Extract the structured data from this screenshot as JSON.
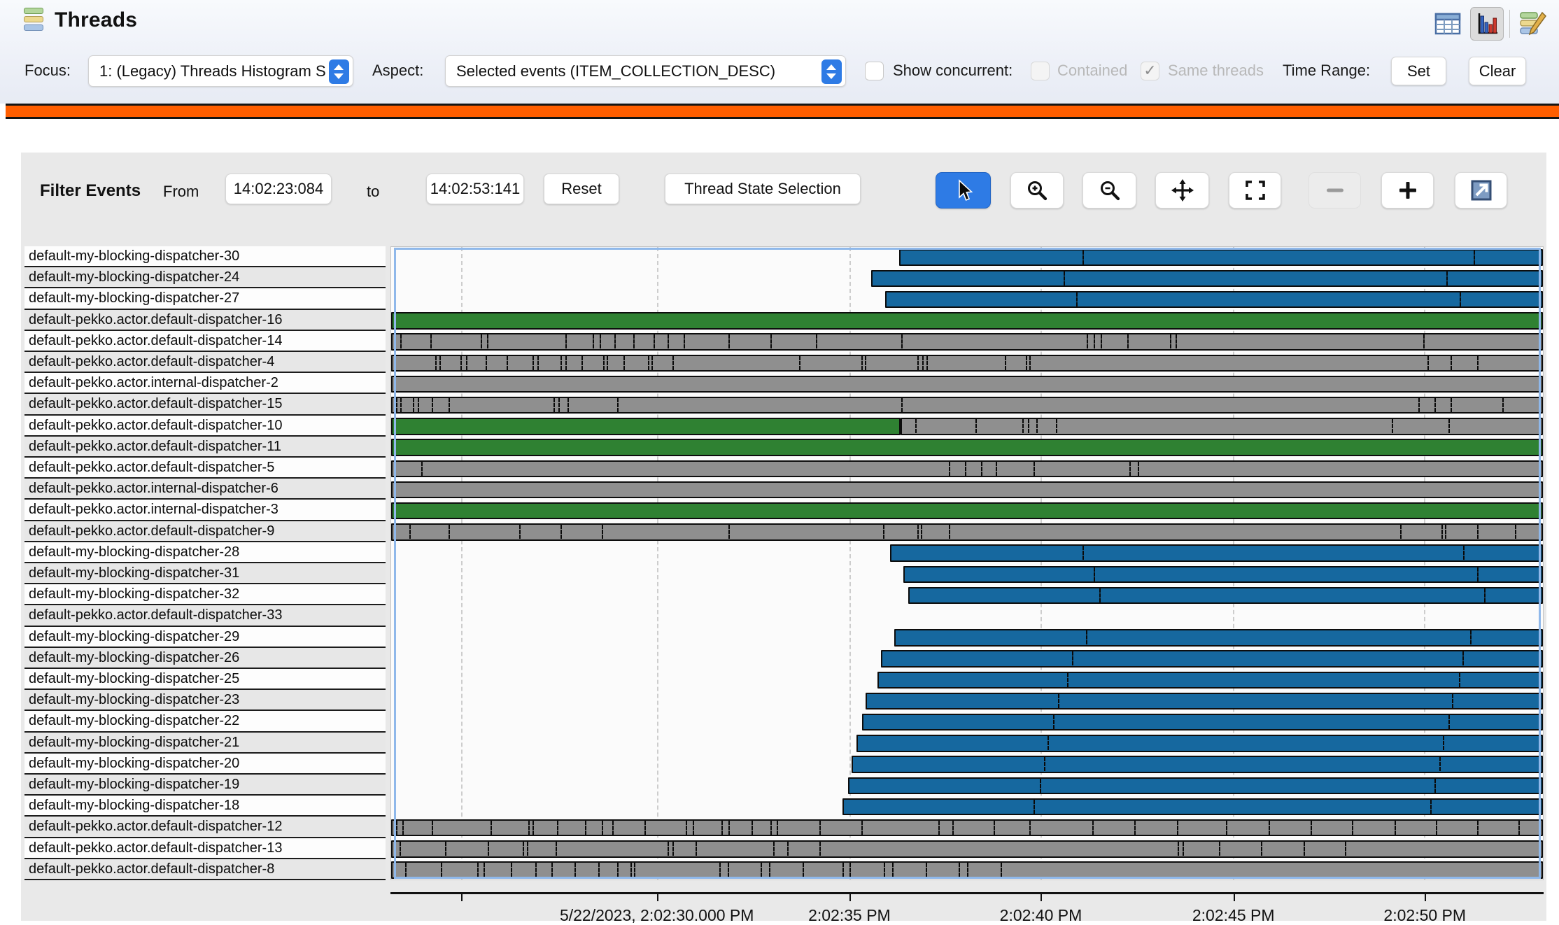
{
  "header": {
    "title": "Threads"
  },
  "controls": {
    "focus_label": "Focus:",
    "focus_value": "1: (Legacy) Threads Histogram S",
    "aspect_label": "Aspect:",
    "aspect_value": "Selected events (ITEM_COLLECTION_DESC)",
    "show_concurrent_label": "Show concurrent:",
    "contained_label": "Contained",
    "same_threads_label": "Same threads",
    "same_threads_check": "✓",
    "time_range_label": "Time Range:",
    "set_label": "Set",
    "clear_label": "Clear"
  },
  "toolbar": {
    "filter_events_label": "Filter Events",
    "from_label": "From",
    "from_value": "14:02:23:084",
    "to_label": "to",
    "to_value": "14:02:53:141",
    "reset_label": "Reset",
    "thread_state_label": "Thread State Selection"
  },
  "colors": {
    "blue": "#16689F",
    "green": "#2F8132",
    "gray": "#8F8F8F",
    "selection": "#8FB8EA",
    "active_tool": "#2E7BE5",
    "orange": "#FF5E00"
  },
  "timeline": {
    "type": "thread-state-timeline",
    "axis": {
      "ticks": [
        {
          "pos": 0.061,
          "label": ""
        },
        {
          "pos": 0.231,
          "label": "5/22/2023, 2:02:30.000 PM"
        },
        {
          "pos": 0.398,
          "label": "2:02:35 PM"
        },
        {
          "pos": 0.564,
          "label": "2:02:40 PM"
        },
        {
          "pos": 0.731,
          "label": "2:02:45 PM"
        },
        {
          "pos": 0.897,
          "label": "2:02:50 PM"
        }
      ]
    },
    "rows": [
      {
        "label": "default-my-blocking-dispatcher-30",
        "segs": [
          [
            "blue",
            0.441,
            1
          ]
        ],
        "ticks": [
          0.6,
          0.94
        ]
      },
      {
        "label": "default-my-blocking-dispatcher-24",
        "segs": [
          [
            "blue",
            0.417,
            1
          ]
        ],
        "ticks": [
          0.584,
          0.916
        ]
      },
      {
        "label": "default-my-blocking-dispatcher-27",
        "segs": [
          [
            "blue",
            0.429,
            1
          ]
        ],
        "ticks": [
          0.595,
          0.928
        ]
      },
      {
        "label": "default-pekko.actor.default-dispatcher-16",
        "segs": [
          [
            "green",
            0,
            1
          ]
        ],
        "ticks": []
      },
      {
        "label": "default-pekko.actor.default-dispatcher-14",
        "segs": [
          [
            "gray",
            0,
            1
          ]
        ],
        "ticks": [
          0.008,
          0.034,
          0.078,
          0.083,
          0.151,
          0.175,
          0.181,
          0.194,
          0.21,
          0.228,
          0.24,
          0.254,
          0.293,
          0.329,
          0.369,
          0.443,
          0.604,
          0.61,
          0.616,
          0.639,
          0.676,
          0.681,
          0.896
        ]
      },
      {
        "label": "default-pekko.actor.default-dispatcher-4",
        "segs": [
          [
            "gray",
            0,
            1
          ]
        ],
        "ticks": [
          0.038,
          0.042,
          0.06,
          0.065,
          0.082,
          0.1,
          0.123,
          0.127,
          0.147,
          0.151,
          0.165,
          0.184,
          0.187,
          0.202,
          0.223,
          0.226,
          0.244,
          0.354,
          0.408,
          0.411,
          0.457,
          0.461,
          0.465,
          0.533,
          0.551,
          0.554,
          0.9,
          0.92,
          0.943
        ]
      },
      {
        "label": "default-pekko.actor.internal-dispatcher-2",
        "segs": [
          [
            "gray",
            0,
            1
          ]
        ],
        "ticks": []
      },
      {
        "label": "default-pekko.actor.default-dispatcher-15",
        "segs": [
          [
            "gray",
            0,
            1
          ]
        ],
        "ticks": [
          0.004,
          0.008,
          0.019,
          0.023,
          0.035,
          0.05,
          0.141,
          0.145,
          0.153,
          0.196,
          0.443,
          0.892,
          0.906,
          0.92,
          0.965
        ]
      },
      {
        "label": "default-pekko.actor.default-dispatcher-10",
        "segs": [
          [
            "green",
            0,
            0.442
          ],
          [
            "gray",
            0.442,
            1
          ]
        ],
        "ticks": [
          0.455,
          0.507,
          0.548,
          0.553,
          0.56,
          0.577,
          0.869,
          0.918
        ]
      },
      {
        "label": "default-pekko.actor.default-dispatcher-11",
        "segs": [
          [
            "green",
            0,
            1
          ]
        ],
        "ticks": []
      },
      {
        "label": "default-pekko.actor.default-dispatcher-5",
        "segs": [
          [
            "gray",
            0,
            1
          ]
        ],
        "ticks": [
          0.026,
          0.484,
          0.498,
          0.512,
          0.525,
          0.558,
          0.641,
          0.648
        ]
      },
      {
        "label": "default-pekko.actor.internal-dispatcher-6",
        "segs": [
          [
            "gray",
            0,
            1
          ]
        ],
        "ticks": []
      },
      {
        "label": "default-pekko.actor.internal-dispatcher-3",
        "segs": [
          [
            "green",
            0,
            1
          ]
        ],
        "ticks": []
      },
      {
        "label": "default-pekko.actor.default-dispatcher-9",
        "segs": [
          [
            "gray",
            0,
            1
          ]
        ],
        "ticks": [
          0.016,
          0.05,
          0.111,
          0.147,
          0.183,
          0.293,
          0.427,
          0.457,
          0.46,
          0.484,
          0.876,
          0.912,
          0.915,
          0.943,
          0.976
        ]
      },
      {
        "label": "default-my-blocking-dispatcher-28",
        "segs": [
          [
            "blue",
            0.433,
            1
          ]
        ],
        "ticks": [
          0.6,
          0.931
        ]
      },
      {
        "label": "default-my-blocking-dispatcher-31",
        "segs": [
          [
            "blue",
            0.445,
            1
          ]
        ],
        "ticks": [
          0.61,
          0.943
        ]
      },
      {
        "label": "default-my-blocking-dispatcher-32",
        "segs": [
          [
            "blue",
            0.449,
            1
          ]
        ],
        "ticks": [
          0.615,
          0.949
        ]
      },
      {
        "label": "default-pekko.actor.default-dispatcher-33",
        "segs": [],
        "ticks": []
      },
      {
        "label": "default-my-blocking-dispatcher-29",
        "segs": [
          [
            "blue",
            0.437,
            1
          ]
        ],
        "ticks": [
          0.603,
          0.937
        ]
      },
      {
        "label": "default-my-blocking-dispatcher-26",
        "segs": [
          [
            "blue",
            0.425,
            1
          ]
        ],
        "ticks": [
          0.591,
          0.93
        ]
      },
      {
        "label": "default-my-blocking-dispatcher-25",
        "segs": [
          [
            "blue",
            0.422,
            1
          ]
        ],
        "ticks": [
          0.587,
          0.927
        ]
      },
      {
        "label": "default-my-blocking-dispatcher-23",
        "segs": [
          [
            "blue",
            0.412,
            1
          ]
        ],
        "ticks": [
          0.579,
          0.921
        ]
      },
      {
        "label": "default-my-blocking-dispatcher-22",
        "segs": [
          [
            "blue",
            0.409,
            1
          ]
        ],
        "ticks": [
          0.575,
          0.918
        ]
      },
      {
        "label": "default-my-blocking-dispatcher-21",
        "segs": [
          [
            "blue",
            0.404,
            1
          ]
        ],
        "ticks": [
          0.57,
          0.913
        ]
      },
      {
        "label": "default-my-blocking-dispatcher-20",
        "segs": [
          [
            "blue",
            0.4,
            1
          ]
        ],
        "ticks": [
          0.567,
          0.91
        ]
      },
      {
        "label": "default-my-blocking-dispatcher-19",
        "segs": [
          [
            "blue",
            0.397,
            1
          ]
        ],
        "ticks": [
          0.563,
          0.906
        ]
      },
      {
        "label": "default-my-blocking-dispatcher-18",
        "segs": [
          [
            "blue",
            0.392,
            1
          ]
        ],
        "ticks": [
          0.558,
          0.902
        ]
      },
      {
        "label": "default-pekko.actor.default-dispatcher-12",
        "segs": [
          [
            "gray",
            0,
            1
          ]
        ],
        "ticks": [
          0.004,
          0.01,
          0.035,
          0.086,
          0.119,
          0.123,
          0.144,
          0.168,
          0.183,
          0.192,
          0.22,
          0.256,
          0.262,
          0.287,
          0.293,
          0.313,
          0.329,
          0.335,
          0.372,
          0.408,
          0.475,
          0.487,
          0.523,
          0.554,
          0.609,
          0.645,
          0.682,
          0.725,
          0.762,
          0.798,
          0.834,
          0.871,
          0.907,
          0.943,
          0.979
        ]
      },
      {
        "label": "default-pekko.actor.default-dispatcher-13",
        "segs": [
          [
            "gray",
            0,
            1
          ]
        ],
        "ticks": [
          0.007,
          0.047,
          0.084,
          0.114,
          0.118,
          0.143,
          0.24,
          0.244,
          0.264,
          0.332,
          0.344,
          0.372,
          0.683,
          0.687,
          0.719,
          0.755,
          0.792,
          0.828
        ]
      },
      {
        "label": "default-pekko.actor.default-dispatcher-8",
        "segs": [
          [
            "gray",
            0,
            1
          ]
        ],
        "ticks": [
          0.012,
          0.043,
          0.075,
          0.08,
          0.104,
          0.125,
          0.139,
          0.159,
          0.18,
          0.196,
          0.208,
          0.211,
          0.285,
          0.292,
          0.321,
          0.328,
          0.357,
          0.392,
          0.398,
          0.428,
          0.435,
          0.464,
          0.493,
          0.5,
          0.529
        ]
      }
    ]
  }
}
